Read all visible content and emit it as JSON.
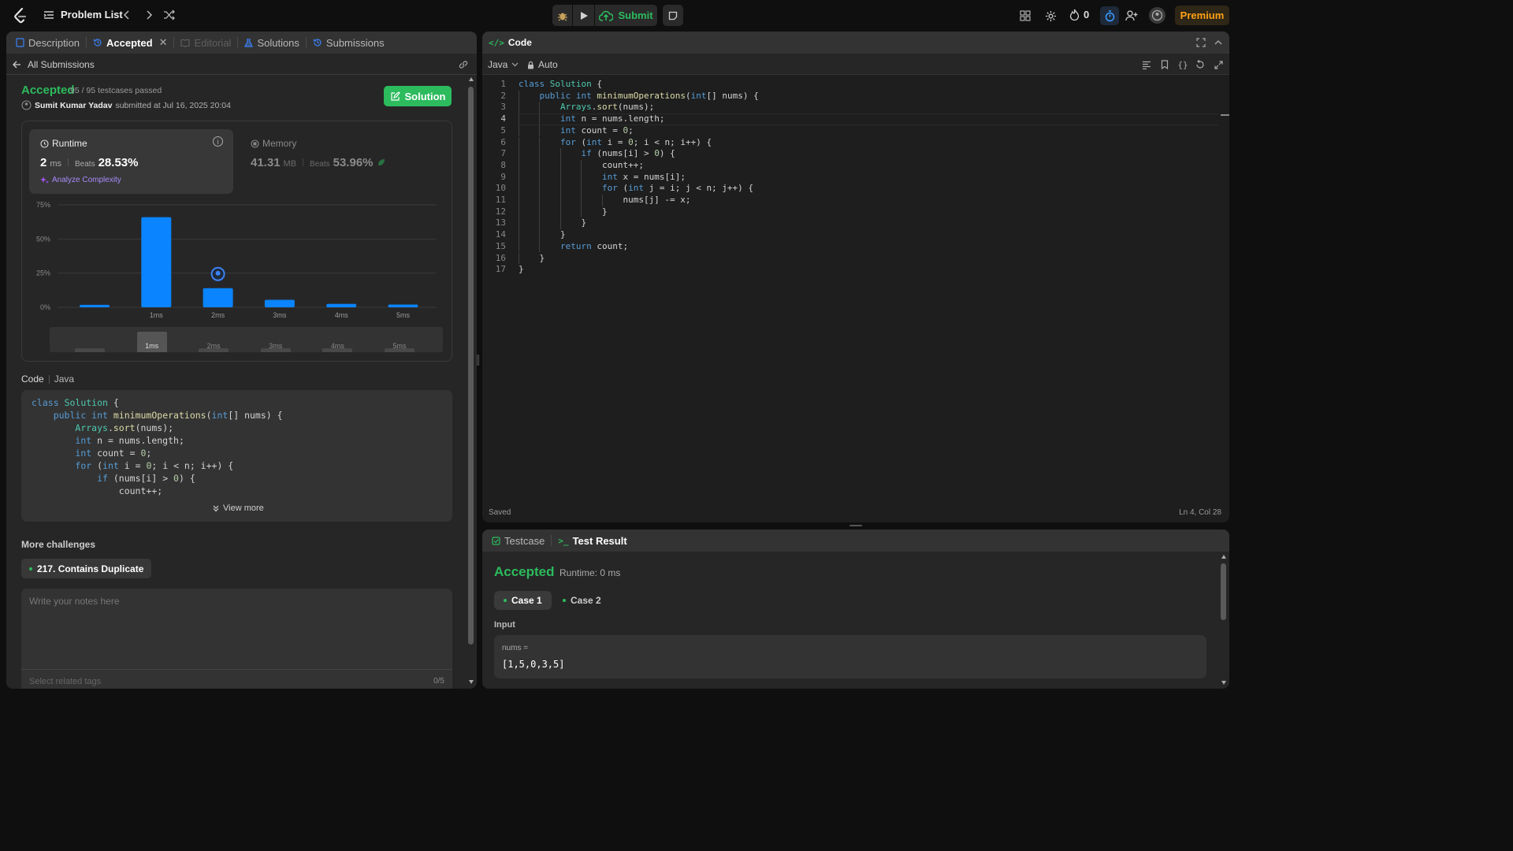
{
  "topbar": {
    "problem_list": "Problem List",
    "submit": "Submit",
    "fire_count": "0",
    "premium": "Premium"
  },
  "left": {
    "tabs": [
      "Description",
      "Accepted",
      "Editorial",
      "Solutions",
      "Submissions"
    ],
    "all_submissions": "All Submissions",
    "status": "Accepted",
    "testcases": "95 / 95 testcases passed",
    "user": "Sumit Kumar Yadav",
    "submitted": "submitted at Jul 16, 2025 20:04",
    "solution_btn": "Solution",
    "runtime_label": "Runtime",
    "runtime_value": "2",
    "runtime_unit": "ms",
    "beats_label": "Beats",
    "runtime_beats": "28.53%",
    "analyze": "Analyze Complexity",
    "memory_label": "Memory",
    "memory_value": "41.31",
    "memory_unit": "MB",
    "memory_beats": "53.96%",
    "code_label": "Code",
    "code_lang": "Java",
    "view_more": "View more",
    "more_challenges": "More challenges",
    "challenge": "217. Contains Duplicate",
    "notes_placeholder": "Write your notes here",
    "tags_placeholder": "Select related tags",
    "tags_count": "0/5"
  },
  "chart_data": {
    "type": "bar",
    "categories": [
      "",
      "1ms",
      "2ms",
      "3ms",
      "4ms",
      "5ms"
    ],
    "values": [
      1.8,
      66,
      14,
      5.5,
      2.5,
      2
    ],
    "ylim": [
      0,
      75
    ],
    "yticks": [
      "75%",
      "50%",
      "25%",
      "0%"
    ],
    "ytick_values": [
      75,
      50,
      25,
      0
    ],
    "highlight_index": 2,
    "accent": "#0a84ff",
    "navigator_labels": [
      "",
      "1ms",
      "2ms",
      "3ms",
      "4ms",
      "5ms"
    ]
  },
  "editor": {
    "title": "Code",
    "language": "Java",
    "mode": "Auto",
    "lines": [
      "class Solution {",
      "    public int minimumOperations(int[] nums) {",
      "        Arrays.sort(nums);",
      "        int n = nums.length;",
      "        int count = 0;",
      "        for (int i = 0; i < n; i++) {",
      "            if (nums[i] > 0) {",
      "                count++;",
      "                int x = nums[i];",
      "                for (int j = i; j < n; j++) {",
      "                    nums[j] -= x;",
      "                }",
      "            }",
      "        }",
      "        return count;",
      "    }",
      "}"
    ],
    "saved": "Saved",
    "cursor": "Ln 4, Col 28"
  },
  "bottom": {
    "tab_testcase": "Testcase",
    "tab_result": "Test Result",
    "status": "Accepted",
    "runtime": "Runtime: 0 ms",
    "cases": [
      "Case 1",
      "Case 2"
    ],
    "input_label": "Input",
    "var_name": "nums =",
    "var_value": "[1,5,0,3,5]"
  }
}
